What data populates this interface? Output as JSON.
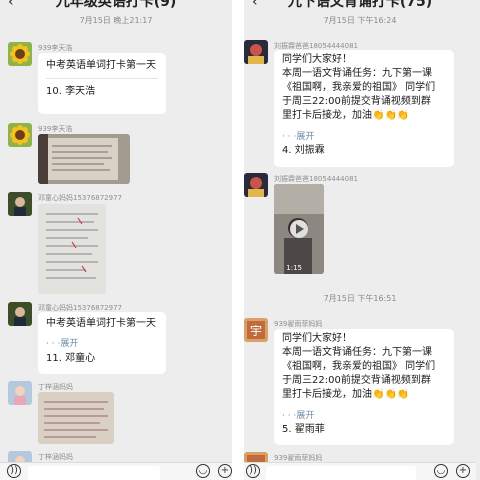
{
  "left": {
    "title": "九年级英语打卡(9)",
    "timestamp": "7月15日 晚上21:17",
    "messages": [
      {
        "sender": "939李天浩",
        "text": "中考英语单词打卡第一天",
        "detail": "10. 李天浩"
      },
      {
        "sender": "939李天浩"
      },
      {
        "sender": "邓童心妈妈15376872977"
      },
      {
        "sender": "邓童心妈妈15376872977",
        "text": "中考英语单词打卡第一天",
        "dots": "· · ·",
        "expand": "展开",
        "detail": "11. 邓童心"
      },
      {
        "sender": "丁梓涵妈妈"
      },
      {
        "sender": "丁梓涵妈妈"
      }
    ]
  },
  "right": {
    "title": "九下语文背诵打卡(75)",
    "timestamp1": "7月15日 下午16:24",
    "timestamp2": "7月15日 下午16:51",
    "messages": [
      {
        "sender": "刘振霖爸爸18054444081",
        "lines": [
          "同学们大家好！",
          "本周一语文背诵任务：九下第一课",
          "《祖国啊，我亲爱的祖国》 同学们",
          "于周三22:00前提交背诵视频到群",
          "里打卡后接龙，加油👏👏👏"
        ],
        "dots": "· · ·",
        "expand": "展开",
        "detail": "4. 刘振霖"
      },
      {
        "sender": "刘振霖爸爸18054444081",
        "duration": "1:15"
      },
      {
        "sender": "939翟雨菲妈妈",
        "lines": [
          "同学们大家好！",
          "本周一语文背诵任务：九下第一课",
          "《祖国啊，我亲爱的祖国》 同学们",
          "于周三22:00前提交背诵视频到群",
          "里打卡后接龙，加油👏👏👏"
        ],
        "dots": "· · ·",
        "expand": "展开",
        "detail": "5. 翟雨菲"
      },
      {
        "sender": "939翟雨菲妈妈"
      }
    ]
  },
  "icons": {
    "back": "back-arrow-icon",
    "voice": "voice-icon",
    "emoji": "emoji-icon",
    "plus": "plus-icon"
  }
}
